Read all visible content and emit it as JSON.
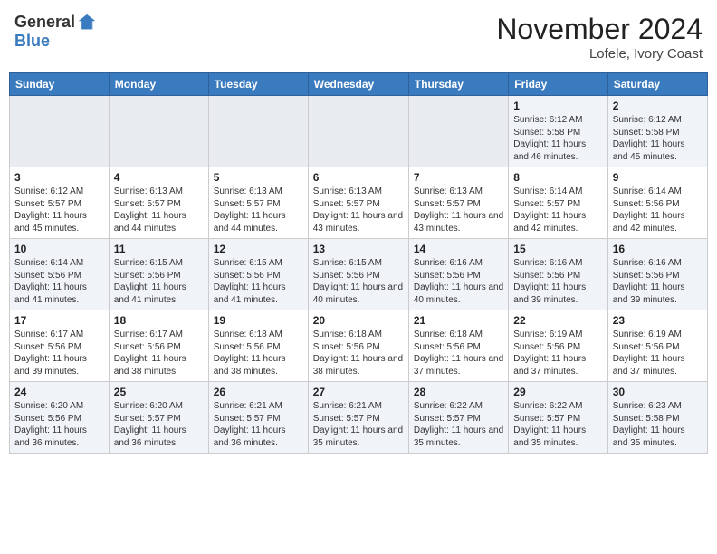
{
  "header": {
    "logo_line1": "General",
    "logo_line2": "Blue",
    "month": "November 2024",
    "location": "Lofele, Ivory Coast"
  },
  "days_of_week": [
    "Sunday",
    "Monday",
    "Tuesday",
    "Wednesday",
    "Thursday",
    "Friday",
    "Saturday"
  ],
  "weeks": [
    [
      {
        "day": "",
        "info": ""
      },
      {
        "day": "",
        "info": ""
      },
      {
        "day": "",
        "info": ""
      },
      {
        "day": "",
        "info": ""
      },
      {
        "day": "",
        "info": ""
      },
      {
        "day": "1",
        "info": "Sunrise: 6:12 AM\nSunset: 5:58 PM\nDaylight: 11 hours and 46 minutes."
      },
      {
        "day": "2",
        "info": "Sunrise: 6:12 AM\nSunset: 5:58 PM\nDaylight: 11 hours and 45 minutes."
      }
    ],
    [
      {
        "day": "3",
        "info": "Sunrise: 6:12 AM\nSunset: 5:57 PM\nDaylight: 11 hours and 45 minutes."
      },
      {
        "day": "4",
        "info": "Sunrise: 6:13 AM\nSunset: 5:57 PM\nDaylight: 11 hours and 44 minutes."
      },
      {
        "day": "5",
        "info": "Sunrise: 6:13 AM\nSunset: 5:57 PM\nDaylight: 11 hours and 44 minutes."
      },
      {
        "day": "6",
        "info": "Sunrise: 6:13 AM\nSunset: 5:57 PM\nDaylight: 11 hours and 43 minutes."
      },
      {
        "day": "7",
        "info": "Sunrise: 6:13 AM\nSunset: 5:57 PM\nDaylight: 11 hours and 43 minutes."
      },
      {
        "day": "8",
        "info": "Sunrise: 6:14 AM\nSunset: 5:57 PM\nDaylight: 11 hours and 42 minutes."
      },
      {
        "day": "9",
        "info": "Sunrise: 6:14 AM\nSunset: 5:56 PM\nDaylight: 11 hours and 42 minutes."
      }
    ],
    [
      {
        "day": "10",
        "info": "Sunrise: 6:14 AM\nSunset: 5:56 PM\nDaylight: 11 hours and 41 minutes."
      },
      {
        "day": "11",
        "info": "Sunrise: 6:15 AM\nSunset: 5:56 PM\nDaylight: 11 hours and 41 minutes."
      },
      {
        "day": "12",
        "info": "Sunrise: 6:15 AM\nSunset: 5:56 PM\nDaylight: 11 hours and 41 minutes."
      },
      {
        "day": "13",
        "info": "Sunrise: 6:15 AM\nSunset: 5:56 PM\nDaylight: 11 hours and 40 minutes."
      },
      {
        "day": "14",
        "info": "Sunrise: 6:16 AM\nSunset: 5:56 PM\nDaylight: 11 hours and 40 minutes."
      },
      {
        "day": "15",
        "info": "Sunrise: 6:16 AM\nSunset: 5:56 PM\nDaylight: 11 hours and 39 minutes."
      },
      {
        "day": "16",
        "info": "Sunrise: 6:16 AM\nSunset: 5:56 PM\nDaylight: 11 hours and 39 minutes."
      }
    ],
    [
      {
        "day": "17",
        "info": "Sunrise: 6:17 AM\nSunset: 5:56 PM\nDaylight: 11 hours and 39 minutes."
      },
      {
        "day": "18",
        "info": "Sunrise: 6:17 AM\nSunset: 5:56 PM\nDaylight: 11 hours and 38 minutes."
      },
      {
        "day": "19",
        "info": "Sunrise: 6:18 AM\nSunset: 5:56 PM\nDaylight: 11 hours and 38 minutes."
      },
      {
        "day": "20",
        "info": "Sunrise: 6:18 AM\nSunset: 5:56 PM\nDaylight: 11 hours and 38 minutes."
      },
      {
        "day": "21",
        "info": "Sunrise: 6:18 AM\nSunset: 5:56 PM\nDaylight: 11 hours and 37 minutes."
      },
      {
        "day": "22",
        "info": "Sunrise: 6:19 AM\nSunset: 5:56 PM\nDaylight: 11 hours and 37 minutes."
      },
      {
        "day": "23",
        "info": "Sunrise: 6:19 AM\nSunset: 5:56 PM\nDaylight: 11 hours and 37 minutes."
      }
    ],
    [
      {
        "day": "24",
        "info": "Sunrise: 6:20 AM\nSunset: 5:56 PM\nDaylight: 11 hours and 36 minutes."
      },
      {
        "day": "25",
        "info": "Sunrise: 6:20 AM\nSunset: 5:57 PM\nDaylight: 11 hours and 36 minutes."
      },
      {
        "day": "26",
        "info": "Sunrise: 6:21 AM\nSunset: 5:57 PM\nDaylight: 11 hours and 36 minutes."
      },
      {
        "day": "27",
        "info": "Sunrise: 6:21 AM\nSunset: 5:57 PM\nDaylight: 11 hours and 35 minutes."
      },
      {
        "day": "28",
        "info": "Sunrise: 6:22 AM\nSunset: 5:57 PM\nDaylight: 11 hours and 35 minutes."
      },
      {
        "day": "29",
        "info": "Sunrise: 6:22 AM\nSunset: 5:57 PM\nDaylight: 11 hours and 35 minutes."
      },
      {
        "day": "30",
        "info": "Sunrise: 6:23 AM\nSunset: 5:58 PM\nDaylight: 11 hours and 35 minutes."
      }
    ]
  ]
}
